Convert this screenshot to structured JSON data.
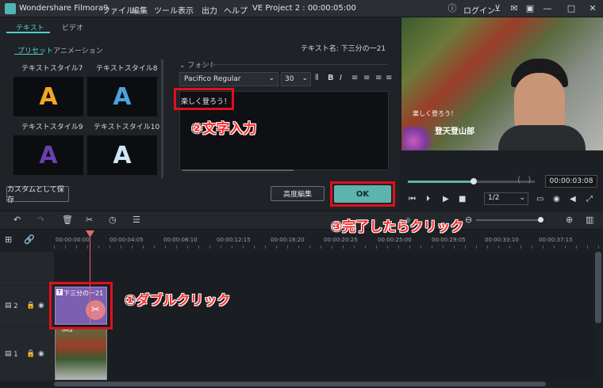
{
  "app": {
    "name": "Wondershare Filmora9",
    "project": "VE Project 2 : 00:00:05:00"
  },
  "menu": [
    "ファイル",
    "編集",
    "ツール",
    "表示",
    "出力",
    "ヘルプ"
  ],
  "titlebar": {
    "login": "ログイン"
  },
  "tabs": {
    "text": "テキスト",
    "video": "ビデオ"
  },
  "subtabs": {
    "preset": "プリセット",
    "animation": "アニメーション"
  },
  "styles": [
    {
      "label": "テキストスタイル7",
      "glyph": "A",
      "color": "#f5a623"
    },
    {
      "label": "テキストスタイル8",
      "glyph": "A",
      "color": "#4aa3df"
    },
    {
      "label": "テキストスタイル9",
      "glyph": "A",
      "color": "#6a3fb0"
    },
    {
      "label": "テキストスタイル10",
      "glyph": "A",
      "color": "#cfe6f5"
    }
  ],
  "buttons": {
    "save_custom": "カスタムとして保存",
    "advanced": "高度編集",
    "ok": "OK"
  },
  "editor": {
    "text_name": "テキスト名: 下三分の一21",
    "font_section": "フォント",
    "font_family": "Pacifico Regular",
    "font_size": "30",
    "text_value": "楽しく登ろう！"
  },
  "preview": {
    "overlay_title": "楽しく登ろう！",
    "overlay_name": "登天登山部",
    "timecode": "00:00:03:08",
    "zoom": "1/2",
    "progress": 0.52
  },
  "ruler": [
    "00:00:00:00",
    "00:00:04:05",
    "00:00:08:10",
    "00:00:12:15",
    "00:00:16:20",
    "00:00:20:25",
    "00:00:25:00",
    "00:00:29:05",
    "00:00:33:10",
    "00:00:37:15"
  ],
  "tracks": [
    {
      "label": "2",
      "clip": "下三分の一21"
    },
    {
      "label": "1",
      "clip": "IMG"
    }
  ],
  "annotations": {
    "step1": "①ダブルクリック",
    "step2": "②文字入力",
    "step3": "③完了したらクリック"
  }
}
